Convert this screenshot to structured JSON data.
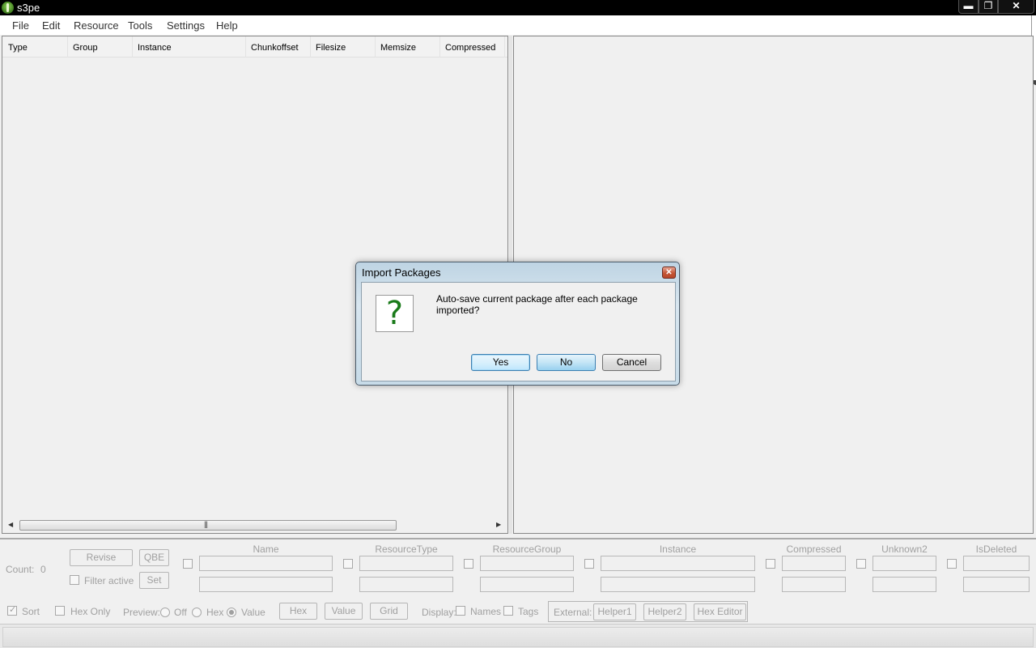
{
  "window": {
    "title": "s3pe",
    "min_glyph": "▬",
    "max_glyph": "❐",
    "close_glyph": "✕"
  },
  "menu": [
    "File",
    "Edit",
    "Resource",
    "Tools",
    "Settings",
    "Help"
  ],
  "list": {
    "columns": [
      "Type",
      "Group",
      "Instance",
      "Chunkoffset",
      "Filesize",
      "Memsize",
      "Compressed"
    ],
    "scroll_left": "◀",
    "scroll_right": "▶",
    "grip": "|||"
  },
  "bottom": {
    "count_label": "Count:",
    "count_value": "0",
    "revise": "Revise",
    "qbe": "QBE",
    "filter_active": "Filter active",
    "set": "Set",
    "columns": [
      "Name",
      "ResourceType",
      "ResourceGroup",
      "Instance",
      "Compressed",
      "Unknown2",
      "IsDeleted"
    ],
    "sort": "Sort",
    "hex_only": "Hex Only",
    "preview_label": "Preview:",
    "preview_options": [
      "Off",
      "Hex",
      "Value"
    ],
    "preview_selected": "Value",
    "hex_btn": "Hex",
    "value_btn": "Value",
    "grid_btn": "Grid",
    "display_label": "Display:",
    "names": "Names",
    "tags": "Tags",
    "external_label": "External:",
    "helper1": "Helper1",
    "helper2": "Helper2",
    "hex_editor": "Hex Editor"
  },
  "dialog": {
    "title": "Import Packages",
    "icon_glyph": "?",
    "message": "Auto-save current package after each package imported?",
    "yes": "Yes",
    "no": "No",
    "cancel": "Cancel"
  }
}
